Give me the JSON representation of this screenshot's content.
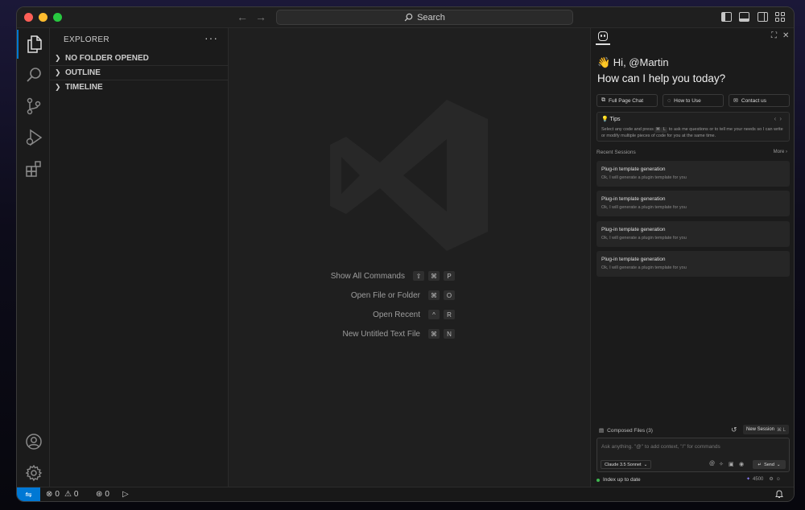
{
  "titlebar": {
    "search_label": "Search",
    "icons": [
      "back-arrow-icon",
      "forward-arrow-icon",
      "search-icon",
      "toggle-sidebar-icon",
      "toggle-panel-icon",
      "toggle-secondary-sidebar-icon",
      "customize-layout-icon"
    ]
  },
  "activitybar": {
    "items": [
      "explorer-icon",
      "search-icon",
      "source-control-icon",
      "run-debug-icon",
      "extensions-icon",
      "account-icon",
      "settings-gear-icon"
    ]
  },
  "sidebar": {
    "title": "EXPLORER",
    "more": "···",
    "sections": [
      {
        "label": "NO FOLDER OPENED"
      },
      {
        "label": "OUTLINE"
      },
      {
        "label": "TIMELINE"
      }
    ]
  },
  "editor": {
    "commands": [
      {
        "label": "Show All Commands",
        "keys": [
          "⇧",
          "⌘",
          "P"
        ]
      },
      {
        "label": "Open File or Folder",
        "keys": [
          "⌘",
          "O"
        ]
      },
      {
        "label": "Open Recent",
        "keys": [
          "^",
          "R"
        ]
      },
      {
        "label": "New Untitled Text File",
        "keys": [
          "⌘",
          "N"
        ]
      }
    ]
  },
  "chat": {
    "greeting": "👋 Hi, @Martin",
    "headline": "How can I help you today?",
    "quick_actions": [
      {
        "label": "Full Page Chat",
        "icon": "⧉"
      },
      {
        "label": "How to Use",
        "icon": "◌"
      },
      {
        "label": "Contact us",
        "icon": "✉"
      }
    ],
    "tips": {
      "title": "💡 Tips",
      "text_before": "Select any code and press",
      "key1": "⌘",
      "key2": "L",
      "text_after": "to ask me questions or to tell me your needs so I can write or modify multiple pieces of code for you at the same time."
    },
    "recent_sessions_label": "Recent Sessions",
    "more_label": "More",
    "sessions": [
      {
        "title": "Plug-in template generation",
        "subtitle": "Ok, I will generate a plugin template for you"
      },
      {
        "title": "Plug-in template generation",
        "subtitle": "Ok, I will generate a plugin template for you"
      },
      {
        "title": "Plug-in template generation",
        "subtitle": "Ok, I will generate a plugin template for you"
      },
      {
        "title": "Plug-in template generation",
        "subtitle": "Ok, I will generate a plugin template for you"
      }
    ],
    "composed_files": "Composed Files (3)",
    "new_session": "New Session",
    "new_session_shortcut": "⌘ L",
    "input_placeholder": "Ask anything. \"@\" to add context, \"/\" for commands",
    "model": "Claude 3.5 Sonnet",
    "send_label": "Send",
    "index_status": "Index up to date",
    "credits": "4500"
  },
  "statusbar": {
    "errors": "0",
    "warnings": "0",
    "ports": "0"
  }
}
